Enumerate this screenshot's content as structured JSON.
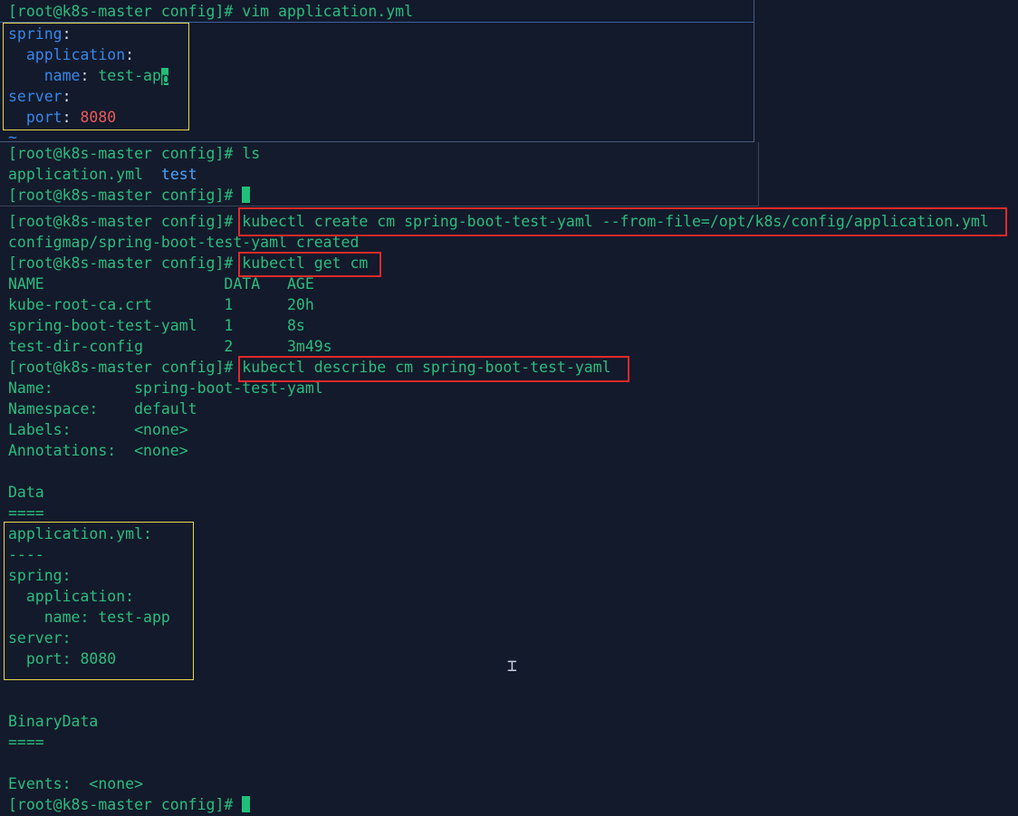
{
  "vim_pane": {
    "command_line": "[root@k8s-master config]# vim application.yml",
    "yaml": {
      "spring_key": "spring",
      "application_key": "  application",
      "name_key": "    name",
      "name_value_prefix": " test-ap",
      "name_value_cursor_char": "p",
      "server_key": "server",
      "port_key": "  port",
      "port_value": " 8080",
      "colon": ":",
      "tilde": "~"
    }
  },
  "ls_pane": {
    "prompt_ls": "[root@k8s-master config]# ls",
    "file_yml": "application.yml  ",
    "dir_test": "test",
    "prompt_empty": "[root@k8s-master config]# "
  },
  "main_pane": {
    "prompt": "[root@k8s-master config]#",
    "cmd_create": " kubectl create cm spring-boot-test-yaml --from-file=/opt/k8s/config/application.yml",
    "out_created": "configmap/spring-boot-test-yaml created",
    "cmd_get": " kubectl get cm",
    "table_header": "NAME                    DATA   AGE",
    "table_rows": [
      "kube-root-ca.crt        1      20h",
      "spring-boot-test-yaml   1      8s",
      "test-dir-config         2      3m49s"
    ],
    "cmd_describe": " kubectl describe cm spring-boot-test-yaml",
    "describe": {
      "name": "Name:         spring-boot-test-yaml",
      "namespace": "Namespace:    default",
      "labels": "Labels:       <none>",
      "annotations": "Annotations:  <none>",
      "data_heading": "Data",
      "data_rule": "====",
      "data_lines": [
        "application.yml:",
        "----",
        "spring:",
        "  application:",
        "    name: test-app",
        "server:",
        "  port: 8080"
      ],
      "binary_heading": "BinaryData",
      "binary_rule": "====",
      "events": "Events:  <none>"
    },
    "final_prompt": "[root@k8s-master config]# "
  },
  "colors": {
    "background": "#131a2b",
    "text_green": "#2bbd7e",
    "yaml_key_blue": "#3a86e8",
    "number_red": "#ec5a5a",
    "highlight_yellow": "#e6d94a",
    "highlight_red": "#e02a2a"
  }
}
